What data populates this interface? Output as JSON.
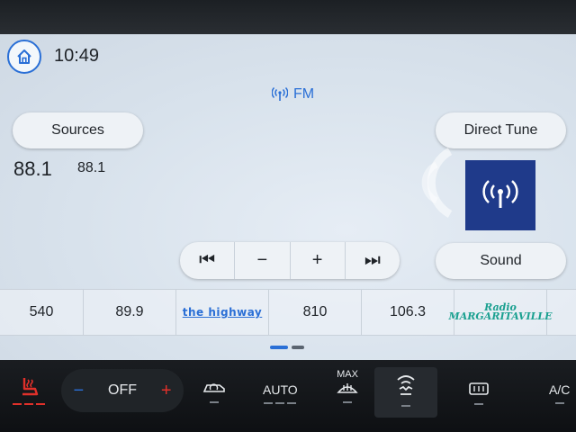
{
  "header": {
    "time": "10:49"
  },
  "audio": {
    "band": "FM",
    "sources_label": "Sources",
    "direct_tune_label": "Direct Tune",
    "sound_label": "Sound",
    "frequency_main": "88.1",
    "frequency_secondary": "88.1"
  },
  "controls": {
    "prev": "⏮",
    "minus": "−",
    "plus": "+",
    "next": "⏭"
  },
  "presets": [
    {
      "label": "540"
    },
    {
      "label": "89.9"
    },
    {
      "label": "the highway",
      "logo": true
    },
    {
      "label": "810"
    },
    {
      "label": "106.3"
    },
    {
      "label": "Radio MARGARITAVILLE",
      "logo": true
    }
  ],
  "climate": {
    "off_label": "OFF",
    "minus": "−",
    "plus": "+",
    "auto_label": "AUTO",
    "max_label": "MAX",
    "ac_label": "A/C"
  },
  "colors": {
    "accent": "#2a6fd6",
    "tile": "#1f3a8a",
    "heat": "#e0302a"
  }
}
